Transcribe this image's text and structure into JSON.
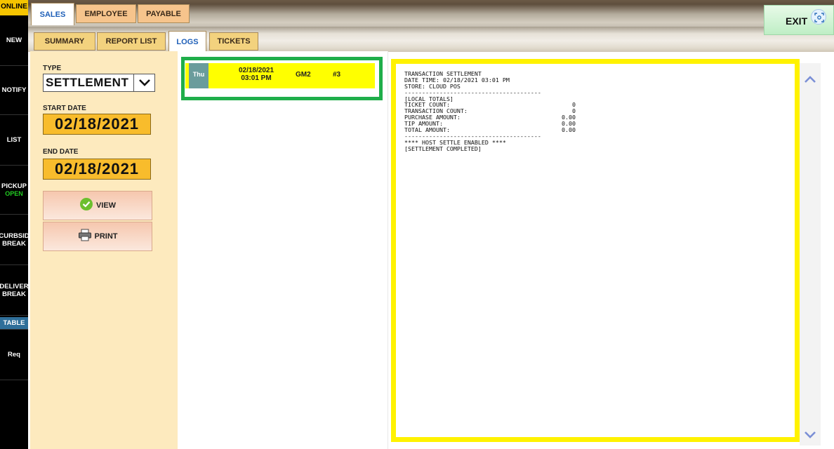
{
  "rail": {
    "online": "ONLINE",
    "new": "NEW",
    "notify": "NOTIFY",
    "list": "LIST",
    "pickup": "PICKUP",
    "pickup_status": "OPEN",
    "curbside": "CURBSID",
    "curbside_status": "BREAK",
    "delivery": "DELIVER",
    "delivery_status": "BREAK",
    "table": "TABLE",
    "req": "Req"
  },
  "top_tabs": [
    "SALES",
    "EMPLOYEE",
    "PAYABLE"
  ],
  "sub_tabs": [
    "SUMMARY",
    "REPORT LIST",
    "LOGS",
    "TICKETS"
  ],
  "exit_label": "EXIT",
  "filter": {
    "type_label": "TYPE",
    "type_value": "SETTLEMENT",
    "start_label": "START DATE",
    "start_date": "02/18/2021",
    "end_label": "END DATE",
    "end_date": "02/18/2021",
    "view_label": "VIEW",
    "print_label": "PRINT"
  },
  "log_entry": {
    "day": "Thu",
    "date": "02/18/2021",
    "time": "03:01 PM",
    "terminal": "GM2",
    "number": "#3"
  },
  "receipt": {
    "header": [
      "TRANSACTION SETTLEMENT",
      "DATE TIME: 02/18/2021 03:01 PM",
      "STORE: CLOUD POS"
    ],
    "divider": "---------------------------------------",
    "section": "[LOCAL TOTALS]",
    "rows": [
      {
        "label": "TICKET COUNT:",
        "value": "0"
      },
      {
        "label": "TRANSACTION COUNT:",
        "value": "0"
      },
      {
        "label": "PURCHASE AMOUNT:",
        "value": "0.00"
      },
      {
        "label": "TIP AMOUNT:",
        "value": "0.00"
      },
      {
        "label": "TOTAL AMOUNT:",
        "value": "0.00"
      }
    ],
    "footer": [
      "**** HOST SETTLE ENABLED ****",
      "[SETTLEMENT COMPLETED]"
    ]
  },
  "colors": {
    "accent_blue": "#1e5fb8",
    "date_box": "#f8bc2c",
    "highlight_green": "#1fae4a",
    "highlight_yellow": "#fff200",
    "row_yellow": "#ffff00"
  }
}
